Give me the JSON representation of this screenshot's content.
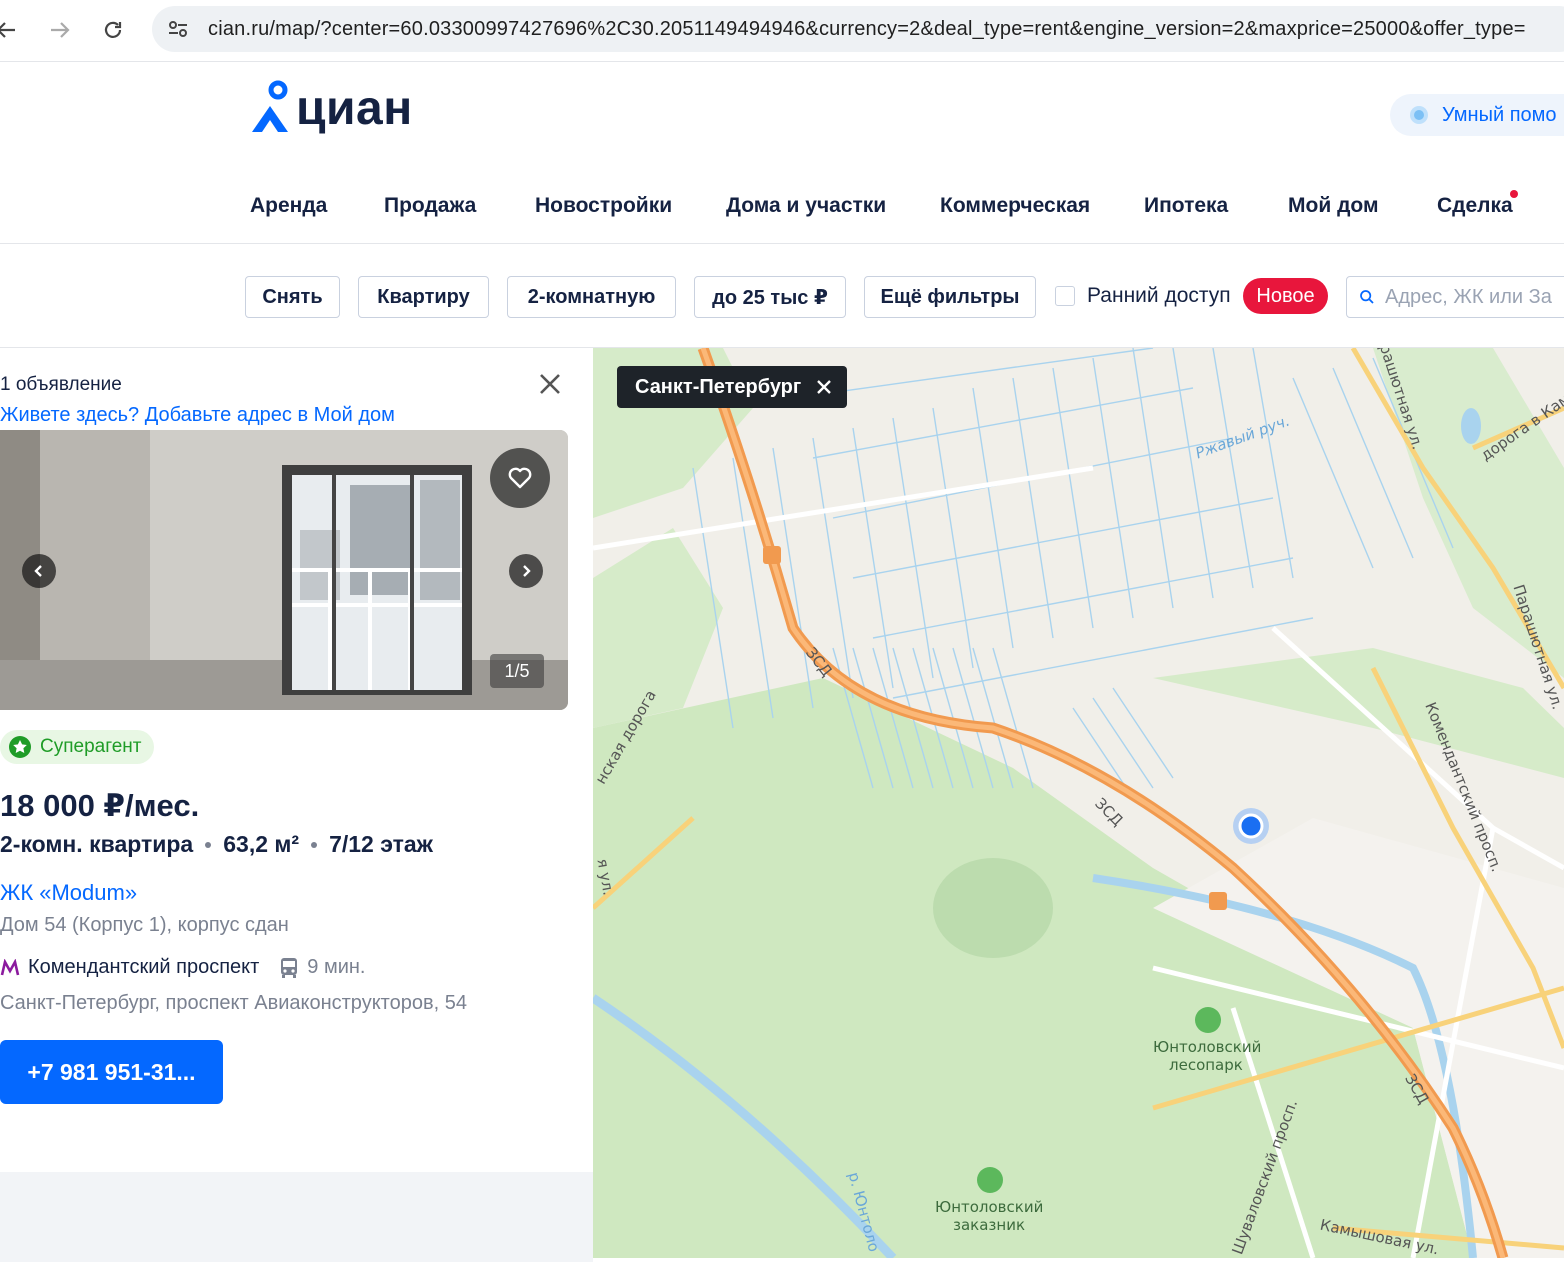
{
  "browser": {
    "url": "cian.ru/map/?center=60.03300997427696%2C30.2051149494946&currency=2&deal_type=rent&engine_version=2&maxprice=25000&offer_type="
  },
  "header": {
    "logo_text": "циан",
    "assistant_label": "Умный помо"
  },
  "nav": {
    "items": [
      "Аренда",
      "Продажа",
      "Новостройки",
      "Дома и участки",
      "Коммерческая",
      "Ипотека",
      "Мой дом",
      "Сделка"
    ]
  },
  "filters": {
    "buttons": [
      "Снять",
      "Квартиру",
      "2-комнатную",
      "до 25 тыс ₽",
      "Ещё фильтры"
    ],
    "early_access_label": "Ранний доступ",
    "new_badge": "Новое",
    "search_placeholder": "Адрес, ЖК или За"
  },
  "listing": {
    "count": "1 объявление",
    "mydom_link": "Живете здесь? Добавьте адрес в Мой дом",
    "photo_counter": "1/5",
    "badge": "Суперагент",
    "price": "18 000 ₽/мес.",
    "rooms": "2-комн. квартира",
    "area": "63,2 м²",
    "floor": "7/12 этаж",
    "complex": "ЖК «Modum»",
    "house": "Дом 54 (Корпус 1), корпус сдан",
    "metro": "Комендантский проспект",
    "metro_time": "9 мин.",
    "address": "Санкт-Петербург, проспект Авиаконструкторов, 54",
    "phone": "+7 981 951-31..."
  },
  "map": {
    "city_chip": "Санкт-Петербург",
    "labels": {
      "zsd_1": "ЗСД",
      "zsd_2": "ЗСД",
      "zsd_3": "ЗСД",
      "stream": "Ржавый руч.",
      "parashyutnaya_1": "Парашютная ул.",
      "parashyutnaya_2": "Парашютная ул.",
      "komendantsky": "Комендантский просп.",
      "doroga": "дорога в Кам",
      "park": "Юнтоловский лесопарк",
      "park_1": "Юнтоловский",
      "park_2": "лесопарк",
      "reserve_1": "Юнтоловский",
      "reserve_2": "заказник",
      "shuvalovsky": "Шуваловский просп.",
      "kamyshovaya": "Камышовая ул.",
      "river": "р. Юнтоло",
      "road_left": "нская дорога",
      "ul_left": "я ул."
    }
  },
  "colors": {
    "brand_blue": "#0468ff",
    "new_red": "#e8163c",
    "superagent_green": "#1f9c27",
    "text_dark": "#152242",
    "map_highway": "#f7a25a"
  }
}
